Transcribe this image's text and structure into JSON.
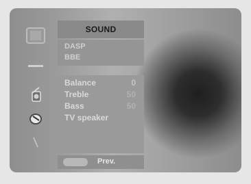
{
  "menu": {
    "title": "SOUND",
    "top_items": [
      {
        "label": "DASP"
      },
      {
        "label": "BBE"
      }
    ],
    "settings": [
      {
        "label": "Balance",
        "value": "0"
      },
      {
        "label": "Treble",
        "value": "50"
      },
      {
        "label": "Bass",
        "value": "50"
      },
      {
        "label": "TV speaker",
        "value": ""
      }
    ],
    "footer": {
      "label": "Prev."
    }
  },
  "side_icons": [
    {
      "name": "tv-icon"
    },
    {
      "name": "minus-icon"
    },
    {
      "name": "speaker-icon"
    },
    {
      "name": "knob-icon"
    },
    {
      "name": "slash-icon"
    }
  ],
  "colors": {
    "title_bg": "#8a8a8a",
    "panel_bg": "#9a9a9a",
    "text": "#d9d9d9"
  }
}
